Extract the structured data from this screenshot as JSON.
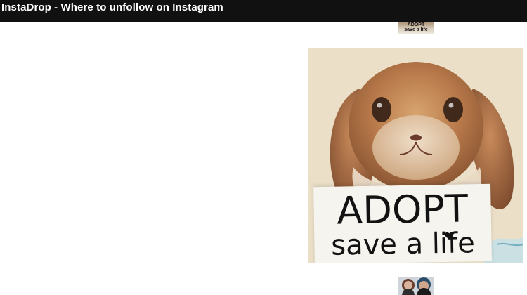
{
  "app": {
    "title": "InstaDrop - Where to unfollow on Instagram"
  },
  "feed": {
    "top_thumbnail": {
      "text_line1": "ADOPT",
      "text_line2": "save a life"
    },
    "preview": {
      "sign_line1": "ADOPT",
      "sign_line2": "save a life"
    },
    "bottom_thumbnail": {}
  },
  "colors": {
    "topbar_bg": "#111111",
    "topbar_text": "#ffffff",
    "page_bg": "#ffffff"
  },
  "icons": {
    "heart_dot": "heart-icon"
  }
}
